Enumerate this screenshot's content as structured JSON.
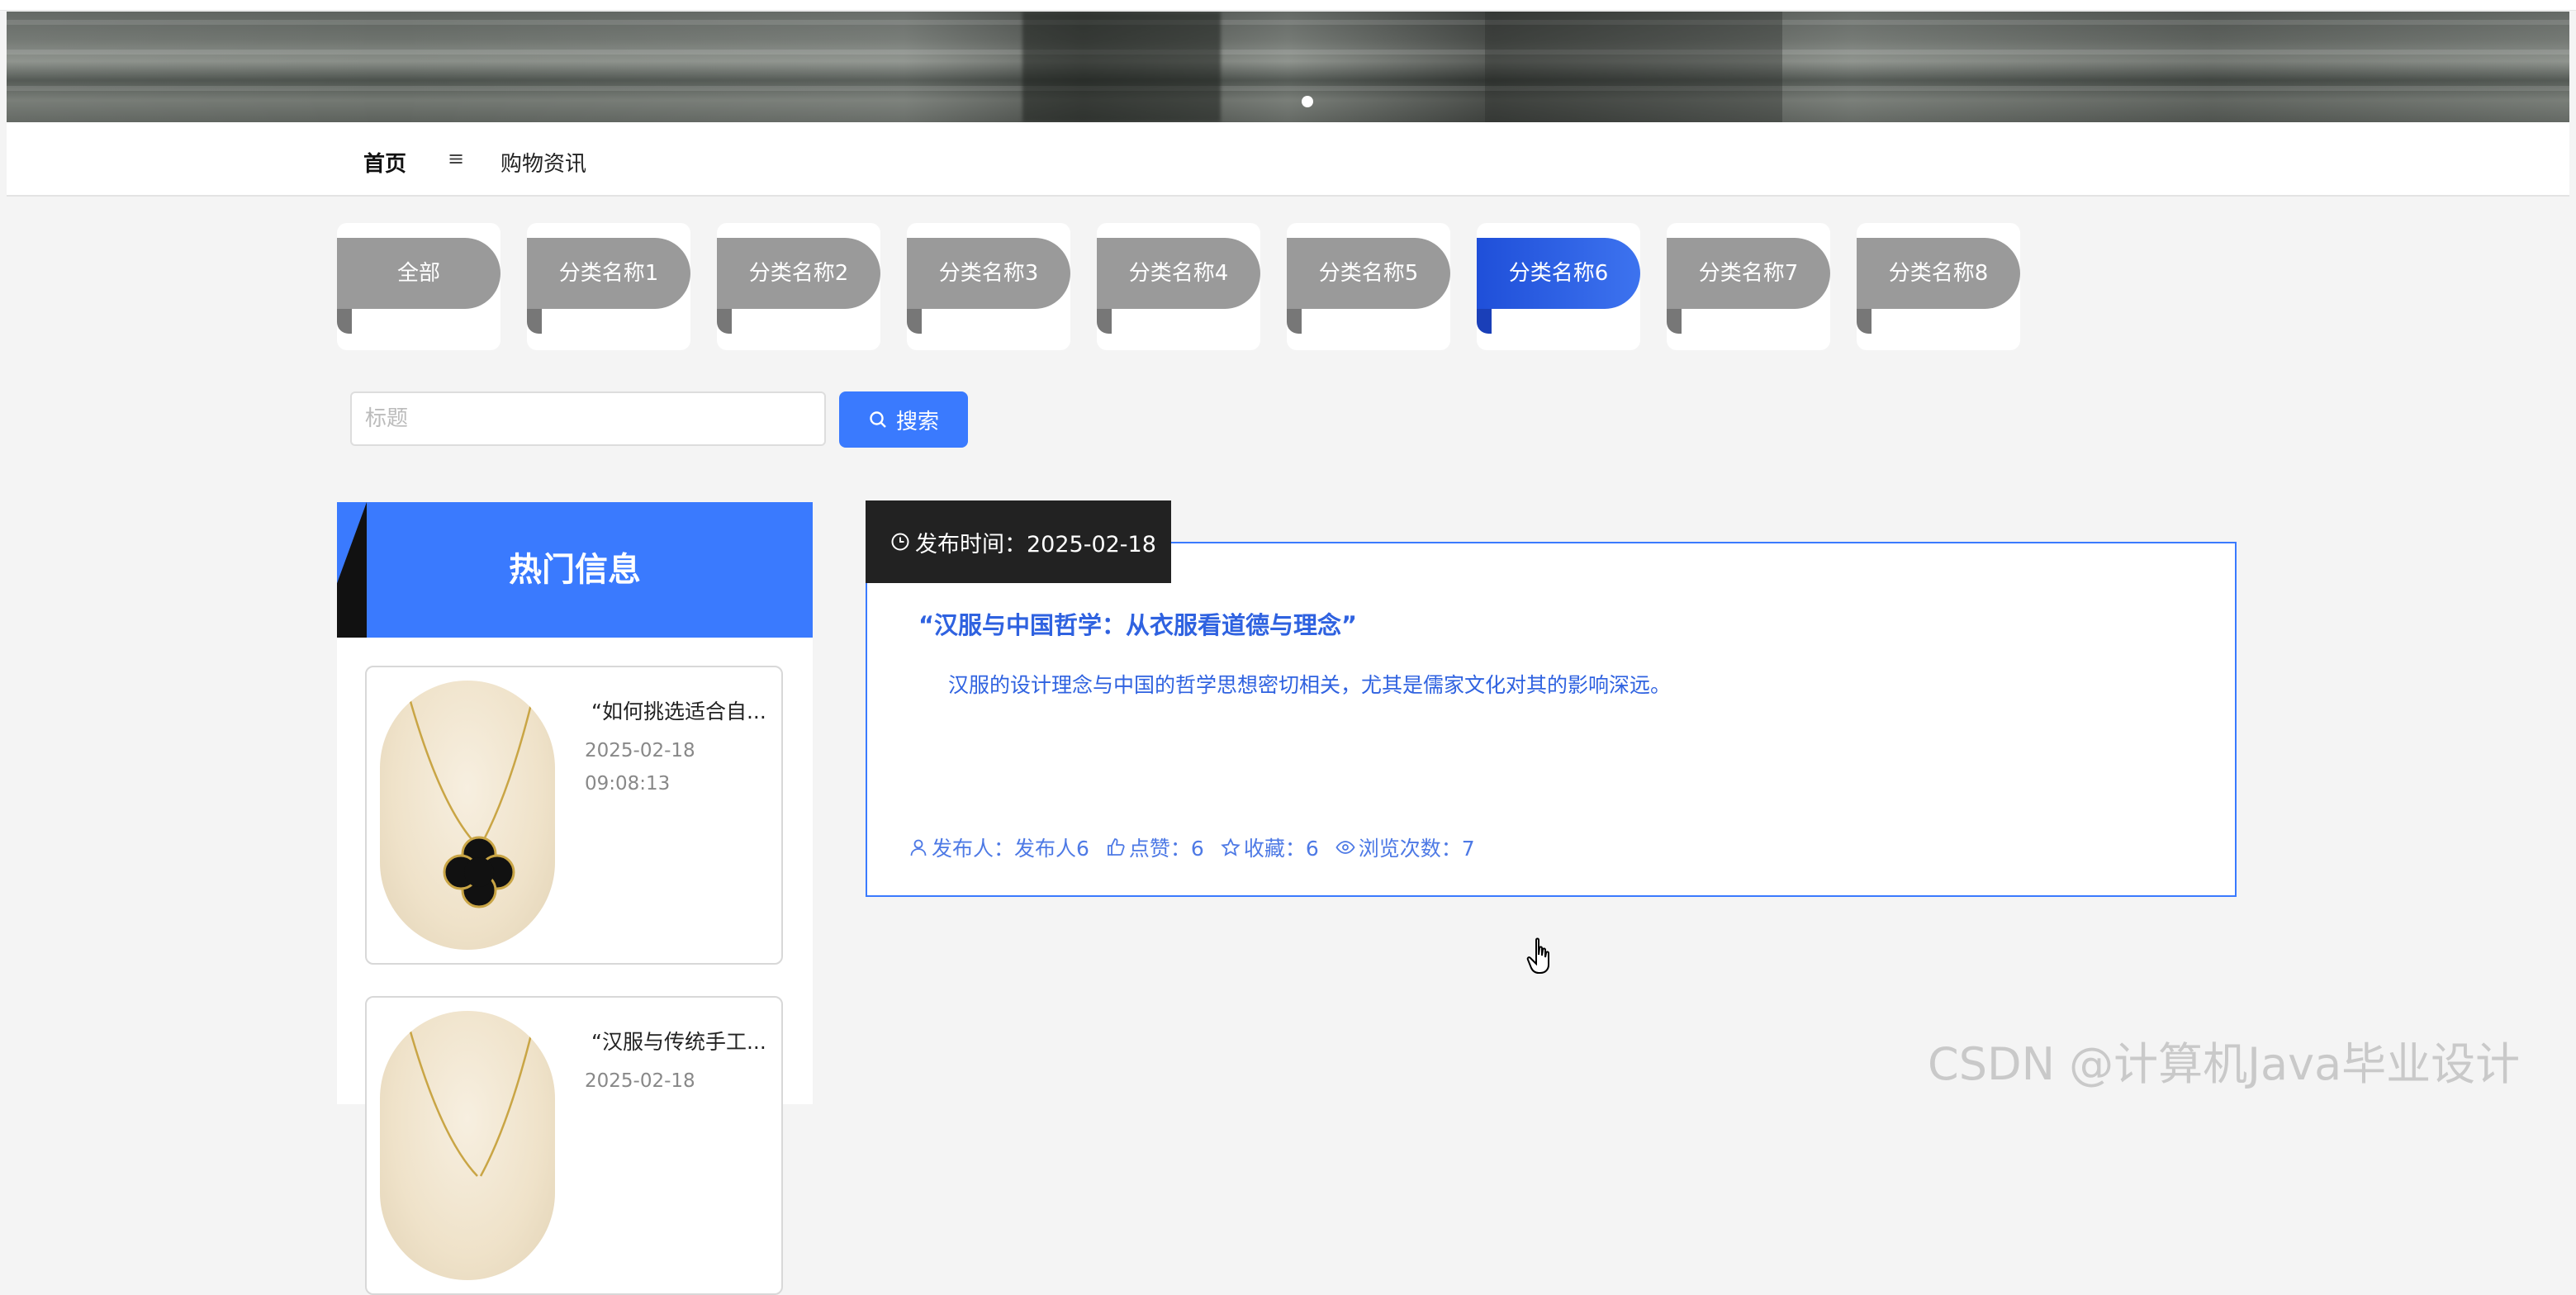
{
  "nav": {
    "home": "首页",
    "menu_icon": "≡",
    "news": "购物资讯"
  },
  "categories": [
    {
      "label": "全部",
      "active": false
    },
    {
      "label": "分类名称1",
      "active": false
    },
    {
      "label": "分类名称2",
      "active": false
    },
    {
      "label": "分类名称3",
      "active": false
    },
    {
      "label": "分类名称4",
      "active": false
    },
    {
      "label": "分类名称5",
      "active": false
    },
    {
      "label": "分类名称6",
      "active": true
    },
    {
      "label": "分类名称7",
      "active": false
    },
    {
      "label": "分类名称8",
      "active": false
    }
  ],
  "search": {
    "placeholder": "标题",
    "button_label": "搜索",
    "icon": "search-icon"
  },
  "hot": {
    "title": "热门信息",
    "items": [
      {
        "title": "“如何挑选适合自...",
        "date": "2025-02-18",
        "time": "09:08:13",
        "image": "necklace-image"
      },
      {
        "title": "“汉服与传统手工...",
        "date": "2025-02-18",
        "time": "",
        "image": "necklace-image"
      }
    ]
  },
  "article": {
    "date_label": "发布时间：2025-02-18",
    "title": "“汉服与中国哲学：从衣服看道德与理念”",
    "description": "汉服的设计理念与中国的哲学思想密切相关，尤其是儒家文化对其的影响深远。",
    "author_label": "发布人：发布人6",
    "likes_label": "点赞：6",
    "favorites_label": "收藏：6",
    "views_label": "浏览次数：7"
  },
  "watermark": "CSDN @计算机Java毕业设计",
  "colors": {
    "primary": "#3a7afe",
    "active_category": "#2653e0",
    "inactive_category": "#9a9a9a"
  }
}
